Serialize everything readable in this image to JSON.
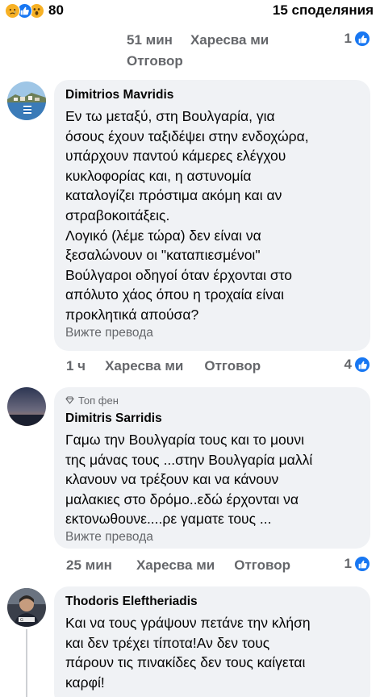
{
  "header": {
    "reactions": [
      "sad-reaction-icon",
      "like-reaction-icon",
      "wow-reaction-icon"
    ],
    "reaction_count": "80",
    "shares": "15 споделяния"
  },
  "thread0": {
    "time": "51 мин",
    "like": "Харесва ми",
    "reply": "Отговор",
    "likes_count": "1"
  },
  "comments": [
    {
      "author": "Dimitrios Mavridis",
      "text": "Εν τω μεταξύ, στη Βουλγαρία, για\nόσους έχουν ταξιδέψει στην ενδοχώρα,\nυπάρχουν παντού κάμερες ελέγχου\nκυκλοφορίας και, η αστυνομία\nκαταλογίζει πρόστιμα ακόμη και αν\nστραβοκοιτάξεις.\nΛογικό (λέμε τώρα) δεν είναι να\nξεσαλώνουν οι \"καταπιεσμένοι\"\nΒούλγαροι οδηγοί όταν έρχονται στο\nαπόλυτο χάος όπου η τροχαία είναι\nπροκλητικά απούσα?",
      "translate": "Вижте превода",
      "time": "1 ч",
      "like": "Харесва ми",
      "reply": "Отговор",
      "likes_count": "4"
    },
    {
      "badge": "Топ фен",
      "author": "Dimitris Sarridis",
      "text": "Γαμω την Βουλγαρία τους και το μουνι\nτης μάνας τους ...στην Βουλγαρία μαλλί\nκλανουν να τρέξουν και να κάνουν\nμαλακιες στο δρόμο..εδώ έρχονται να\nεκτονωθουνε....ρε γαματε τους ...",
      "translate": "Вижте превода",
      "time": "25 мин",
      "like": "Харесва ми",
      "reply": "Отговор",
      "likes_count": "1"
    },
    {
      "author": "Thodoris Eleftheriadis",
      "text": "Και να τους γράψουν πετάνε την κλήση\nκαι δεν τρέχει τίποτα!Αν δεν τους\nπάρουν τις πινακίδες δεν τους καίγεται\nκαρφί!"
    }
  ]
}
